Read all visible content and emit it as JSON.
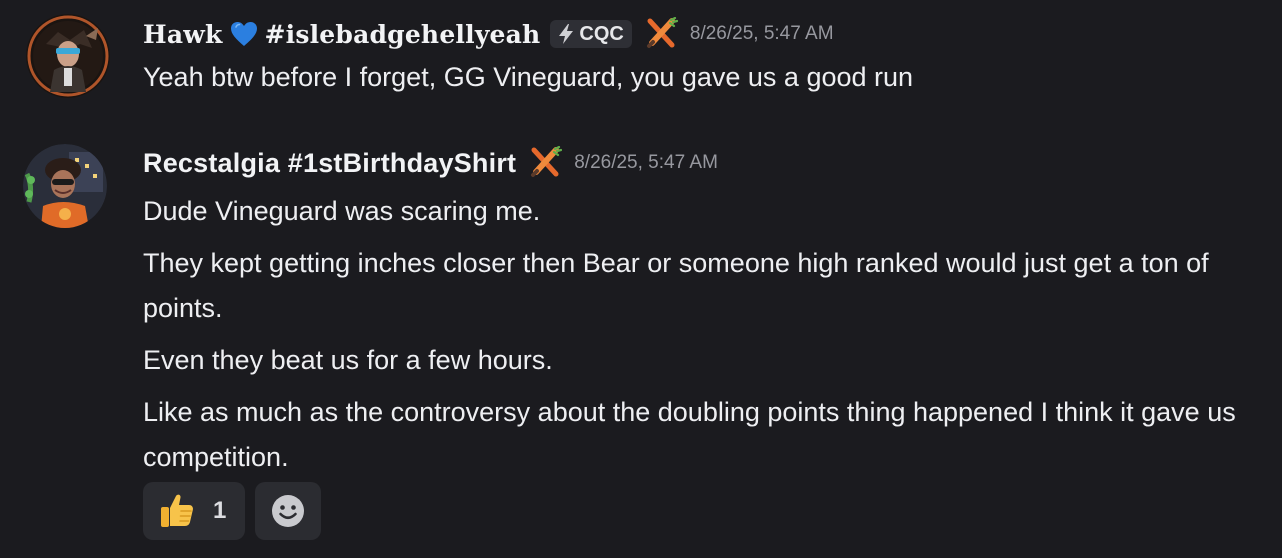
{
  "messages": [
    {
      "username": "Hawk",
      "username_suffix": "#islebadgehellyeah",
      "heart_icon": "blue-heart-icon",
      "tag": {
        "icon": "lightning-bolt-icon",
        "label": "CQC"
      },
      "role_icon": "crossed-carrot-sword-icon",
      "timestamp": "8/26/25, 5:47 AM",
      "lines": [
        "Yeah btw before I forget, GG Vineguard, you gave us a good run"
      ]
    },
    {
      "username": "Recstalgia #1stBirthdayShirt",
      "role_icon": "crossed-carrot-sword-icon",
      "timestamp": "8/26/25, 5:47 AM",
      "lines": [
        "Dude Vineguard was scaring me.",
        "They kept getting inches closer then Bear or someone high ranked would just get a ton of points.",
        "Even they beat us for a few hours.",
        "Like as much as the controversy about the doubling points thing happened I think it gave us competition."
      ],
      "reactions": [
        {
          "emoji": "thumbs-up-icon",
          "count": "1"
        }
      ],
      "add_reaction_icon": "smile-add-reaction-icon"
    }
  ],
  "colors": {
    "background": "#1b1b1f",
    "username": "#f2f3f5",
    "timestamp": "#97989f",
    "text": "#eeeff2",
    "badge_bg": "#2e2f35",
    "reaction_bg": "#2b2c31",
    "heart": "#2b7fe0",
    "carrot": "#f08a3c"
  }
}
